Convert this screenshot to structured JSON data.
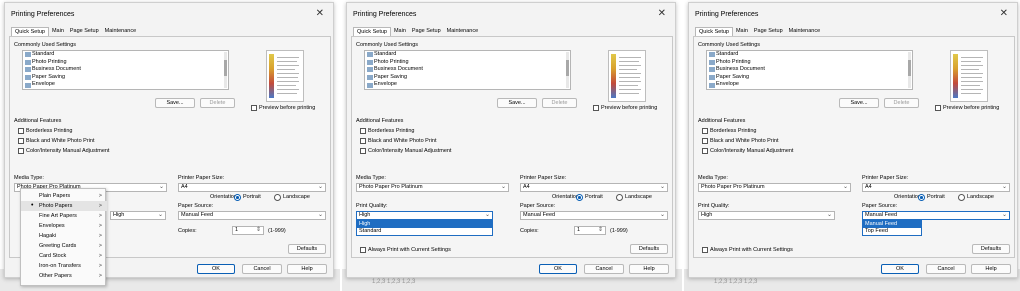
{
  "dialog_title": "Printing Preferences",
  "close_glyph": "✕",
  "tabs": [
    "Quick Setup",
    "Main",
    "Page Setup",
    "Maintenance"
  ],
  "commonly_used_settings_label": "Commonly Used Settings",
  "settings_items": [
    "Standard",
    "Photo Printing",
    "Business Document",
    "Paper Saving",
    "Envelope"
  ],
  "save_label": "Save...",
  "delete_label": "Delete",
  "preview_before_printing": "Preview before printing",
  "additional_features_label": "Additional Features",
  "features": [
    "Borderless Printing",
    "Black and White Photo Print",
    "Color/Intensity Manual Adjustment"
  ],
  "media_type_label": "Media Type:",
  "media_type_value": "Photo Paper Pro Platinum",
  "printer_paper_size_label": "Printer Paper Size:",
  "paper_size_value": "A4",
  "orientation_label": "Orientation:",
  "portrait_label": "Portrait",
  "landscape_label": "Landscape",
  "print_quality_label": "Print Quality:",
  "print_quality_value": "High",
  "quality_options": [
    "High",
    "Standard"
  ],
  "paper_source_label": "Paper Source:",
  "paper_source_value": "Manual Feed",
  "source_options": [
    "Manual Feed",
    "Top Feed"
  ],
  "copies_label": "Copies:",
  "copies_value": "1",
  "copies_range": "(1-999)",
  "defaults_label": "Defaults",
  "always_print_label": "Always Print with Current Settings",
  "ok_label": "OK",
  "cancel_label": "Cancel",
  "help_label": "Help",
  "media_menu": [
    {
      "label": "Plain Papers",
      "selected": false
    },
    {
      "label": "Photo Papers",
      "selected": true
    },
    {
      "label": "Fine Art Papers",
      "selected": false
    },
    {
      "label": "Envelopes",
      "selected": false
    },
    {
      "label": "Hagaki",
      "selected": false
    },
    {
      "label": "Greeting Cards",
      "selected": false
    },
    {
      "label": "Card Stock",
      "selected": false
    },
    {
      "label": "Iron-on Transfers",
      "selected": false
    },
    {
      "label": "Other Papers",
      "selected": false
    }
  ],
  "submenu_arrow": ">",
  "background_text": "1,2,3 1,2,3 1,2,3",
  "colors": {
    "accent": "#1f6dc2",
    "dialog_bg": "#f3f3f3"
  }
}
